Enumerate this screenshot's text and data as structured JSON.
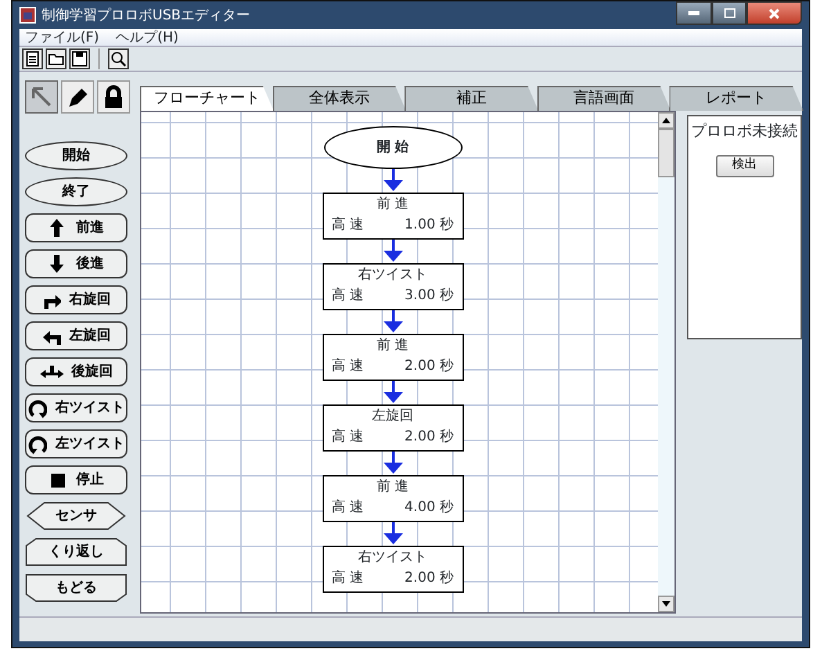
{
  "window": {
    "title": "制御学習プロロボUSBエディター"
  },
  "menu": [
    {
      "label": "ファイル(F)"
    },
    {
      "label": "ヘルプ(H)"
    }
  ],
  "tools": [
    {
      "kind": "pointer",
      "selected": true
    },
    {
      "kind": "pencil",
      "selected": false
    },
    {
      "kind": "lock",
      "selected": false
    }
  ],
  "palette": [
    {
      "kind": "start",
      "label": "開始"
    },
    {
      "kind": "end",
      "label": "終了"
    },
    {
      "kind": "forward",
      "label": "前進"
    },
    {
      "kind": "backward",
      "label": "後進"
    },
    {
      "kind": "turn-right",
      "label": "右旋回"
    },
    {
      "kind": "turn-left",
      "label": "左旋回"
    },
    {
      "kind": "turn-back",
      "label": "後旋回"
    },
    {
      "kind": "twist-right",
      "label": "右ツイスト"
    },
    {
      "kind": "twist-left",
      "label": "左ツイスト"
    },
    {
      "kind": "stop",
      "label": "停止"
    },
    {
      "kind": "sensor",
      "label": "センサ"
    },
    {
      "kind": "repeat",
      "label": "くり返し"
    },
    {
      "kind": "return",
      "label": "もどる"
    }
  ],
  "tabs": [
    {
      "label": "フローチャート",
      "selected": true
    },
    {
      "label": "全体表示",
      "selected": false
    },
    {
      "label": "補正",
      "selected": false
    },
    {
      "label": "言語画面",
      "selected": false
    },
    {
      "label": "レポート",
      "selected": false
    }
  ],
  "flowchart": {
    "start": "開 始",
    "blocks": [
      {
        "title": "前 進",
        "speed": "高 速",
        "time": "1.00 秒"
      },
      {
        "title": "右ツイスト",
        "speed": "高 速",
        "time": "3.00 秒"
      },
      {
        "title": "前 進",
        "speed": "高 速",
        "time": "2.00 秒"
      },
      {
        "title": "左旋回",
        "speed": "高 速",
        "time": "2.00 秒"
      },
      {
        "title": "前 進",
        "speed": "高 速",
        "time": "4.00 秒"
      },
      {
        "title": "右ツイスト",
        "speed": "高 速",
        "time": "2.00 秒"
      }
    ]
  },
  "robot_panel": {
    "status": "プロロボ未接続",
    "button": "検出"
  }
}
